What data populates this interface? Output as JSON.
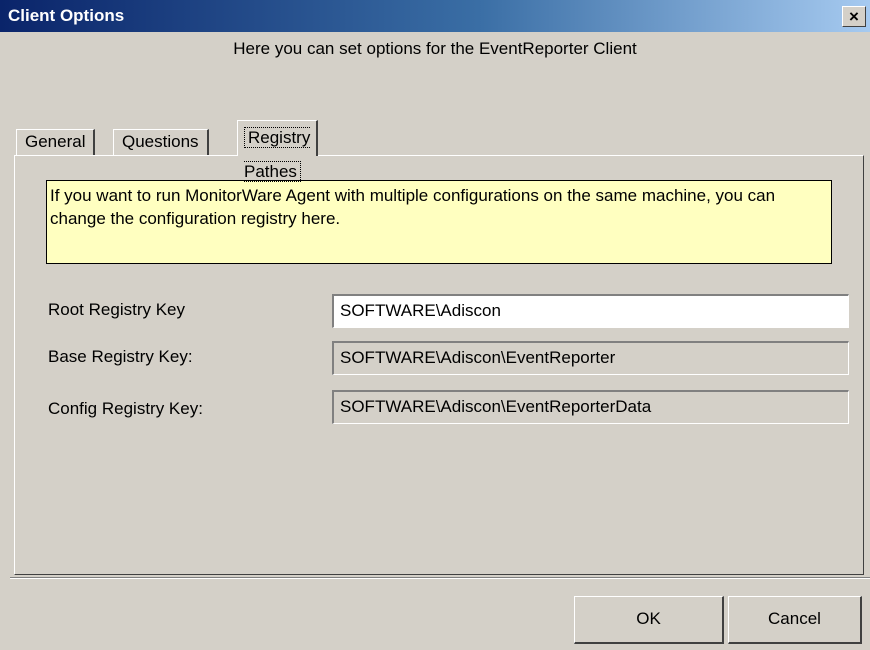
{
  "window": {
    "title": "Client Options",
    "close_icon": "close-icon",
    "close_glyph": "×",
    "subtitle": "Here you can set options for the EventReporter Client"
  },
  "tabs": [
    {
      "label": "General",
      "active": false
    },
    {
      "label": "Questions",
      "active": false
    },
    {
      "label": "Registry Pathes",
      "active": true
    }
  ],
  "panel": {
    "info_text": "If you want to run MonitorWare Agent with multiple configurations on the same machine, you can change the configuration registry here.",
    "fields": [
      {
        "label": "Root Registry Key",
        "value": "SOFTWARE\\Adiscon",
        "editable": true
      },
      {
        "label": "Base Registry Key:",
        "value": "SOFTWARE\\Adiscon\\EventReporter",
        "editable": false
      },
      {
        "label": "Config Registry Key:",
        "value": "SOFTWARE\\Adiscon\\EventReporterData",
        "editable": false
      }
    ]
  },
  "buttons": {
    "ok": "OK",
    "cancel": "Cancel"
  },
  "colors": {
    "info_background": "#ffffc0",
    "titlebar_start": "#0a246a",
    "face": "#d4d0c8"
  }
}
